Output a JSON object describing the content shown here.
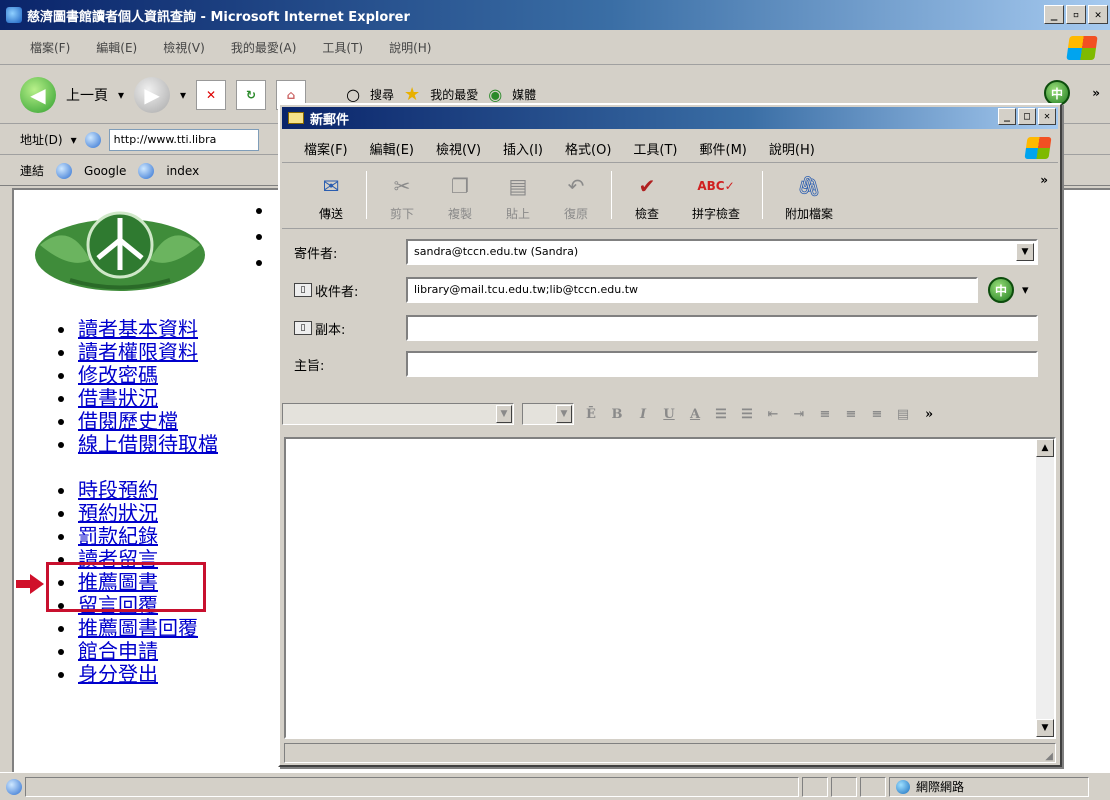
{
  "ie": {
    "title": "慈濟圖書館讀者個人資訊查詢 - Microsoft Internet Explorer",
    "menu": [
      "檔案(F)",
      "編輯(E)",
      "檢視(V)",
      "我的最愛(A)",
      "工具(T)",
      "說明(H)"
    ],
    "toolbar": {
      "back_label": "上一頁",
      "search_label": "搜尋",
      "favorites_label": "我的最愛",
      "media_label": "媒體"
    },
    "address": {
      "label": "地址(D)",
      "value": "http://www.tti.libra"
    },
    "links": {
      "label": "連結",
      "items": [
        "Google",
        "index"
      ]
    },
    "status": {
      "zone": "網際網路"
    }
  },
  "nav": {
    "items": [
      "讀者基本資料",
      "讀者權限資料",
      "修改密碼",
      "借書狀況",
      "借閱歷史檔",
      "線上借閱待取檔",
      "時段預約",
      "預約狀況",
      "罰款紀錄",
      "讀者留言",
      "推薦圖書",
      "留言回覆",
      "推薦圖書回覆",
      "館合申請",
      "身分登出"
    ]
  },
  "mail": {
    "title": "新郵件",
    "menu": [
      "檔案(F)",
      "編輯(E)",
      "檢視(V)",
      "插入(I)",
      "格式(O)",
      "工具(T)",
      "郵件(M)",
      "說明(H)"
    ],
    "toolbar": [
      {
        "label": "傳送",
        "icon": "send-icon",
        "enabled": true
      },
      {
        "label": "剪下",
        "icon": "cut-icon",
        "enabled": false
      },
      {
        "label": "複製",
        "icon": "copy-icon",
        "enabled": false
      },
      {
        "label": "貼上",
        "icon": "paste-icon",
        "enabled": false
      },
      {
        "label": "復原",
        "icon": "undo-icon",
        "enabled": false
      },
      {
        "label": "檢查",
        "icon": "check-names-icon",
        "enabled": true
      },
      {
        "label": "拼字檢查",
        "icon": "spelling-icon",
        "enabled": true
      },
      {
        "label": "附加檔案",
        "icon": "attach-icon",
        "enabled": true
      }
    ],
    "from_label": "寄件者:",
    "from_value": "sandra@tccn.edu.tw   (Sandra)",
    "to_label": "收件者:",
    "to_value": "library@mail.tcu.edu.tw;lib@tccn.edu.tw",
    "cc_label": "副本:",
    "cc_value": "",
    "subject_label": "主旨:",
    "subject_value": "",
    "badge": "中"
  }
}
